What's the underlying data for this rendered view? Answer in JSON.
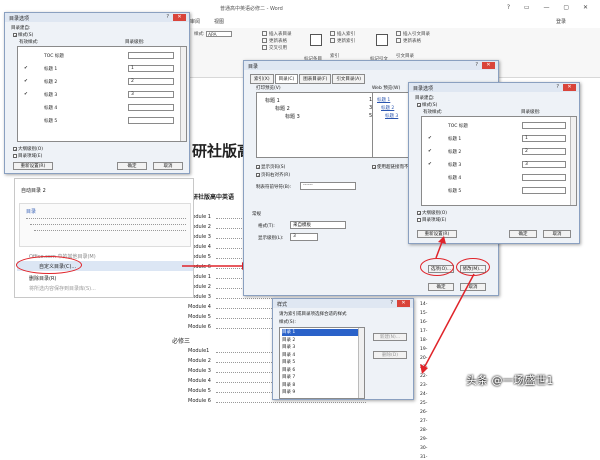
{
  "word": {
    "title": "普通高中英语必修二 - Word",
    "window_controls": "? ▭ — ▢ ✕",
    "signin": "登录",
    "tabs": [
      "审阅",
      "视图"
    ],
    "ribbon": {
      "insert_index": "插入索引",
      "update_index": "更新索引",
      "insert_caption": "插入表目录",
      "update_table": "更新表格",
      "cross_ref": "交叉引用",
      "mark_entry": "标记条目",
      "mark_citation": "标记引文",
      "insert_toa": "插入引文目录",
      "update_toa": "更新表格",
      "style_value": "APA",
      "group_index": "索引",
      "group_toa": "引文目录"
    }
  },
  "document": {
    "heading": "研社版高",
    "subheading": "研社版高中英语",
    "modules": [
      "Module 1",
      "Module 2",
      "Module 3",
      "Module 4",
      "Module 5",
      "Module 6",
      "Module 1",
      "Module 2",
      "Module 3",
      "Module 4",
      "Module 5",
      "Module 6",
      "Module1",
      "Module 2",
      "Module 3",
      "Module 4",
      "Module 5",
      "Module 6"
    ],
    "section_label": "必修三",
    "page_numbers": [
      "10-",
      "11-",
      "12-",
      "13-",
      "14-",
      "15-",
      "16-",
      "17-",
      "18-",
      "19-",
      "20-",
      "21-",
      "22-",
      "23-",
      "24-",
      "25-",
      "26-",
      "27-",
      "28-",
      "29-",
      "30-",
      "31-"
    ]
  },
  "dialog_styles_small": {
    "title": "目录选项",
    "build_from": "目录建自:",
    "styles_check": "样式(S)",
    "available": "有效样式:",
    "toc_level": "目录级别:",
    "rows": [
      {
        "name": "TOC 标题",
        "check": "",
        "level": ""
      },
      {
        "name": "标题 1",
        "check": "✔",
        "level": "1"
      },
      {
        "name": "标题 2",
        "check": "✔",
        "level": "2"
      },
      {
        "name": "标题 3",
        "check": "✔",
        "level": "3"
      },
      {
        "name": "标题 4",
        "check": "",
        "level": ""
      },
      {
        "name": "标题 5",
        "check": "",
        "level": ""
      }
    ],
    "outline": "大纲级别(O)",
    "fields": "目录项域(E)",
    "reset": "重新设置(R)",
    "ok": "确定",
    "cancel": "取消"
  },
  "dropdown": {
    "auto_toc2": "自动目录 2",
    "toc_label": "目录",
    "item_custom": "自定义目录(C)...",
    "item_more": "Office.com 中的其他目录(M)",
    "item_remove": "删除目录(R)",
    "item_save": "将所选内容保存到目录库(S)..."
  },
  "dialog_toc": {
    "title": "目录",
    "tabs": [
      "索引(X)",
      "目录(C)",
      "图表目录(F)",
      "引文目录(A)"
    ],
    "print_preview": "打印预览(V)",
    "web_preview": "Web 预览(W)",
    "preview_items": [
      "标题 1",
      "标题 2",
      "标题 3"
    ],
    "preview_nums": [
      "1",
      "3",
      "5"
    ],
    "web_items": [
      "标题 1",
      "标题 2",
      "标题 3"
    ],
    "show_pages": "显示页码(S)",
    "right_align": "页码右对齐(R)",
    "tab_leader": "制表符前导符(B):",
    "tab_leader_value": "------",
    "use_hyperlinks": "使用超链接而不使用页码(H)",
    "general": "常规",
    "formats": "格式(T):",
    "formats_value": "来自模板",
    "show_levels": "显示级别(L):",
    "show_levels_value": "3",
    "options": "选项(O)...",
    "modify": "修改(M)...",
    "ok": "确定",
    "cancel": "取消"
  },
  "dialog_styles_right": {
    "title": "目录选项",
    "build_from": "目录建自:",
    "styles_check": "样式(S)",
    "available": "有效样式:",
    "toc_level": "目录级别:",
    "rows": [
      {
        "name": "TOC 标题",
        "check": "",
        "level": ""
      },
      {
        "name": "标题 1",
        "check": "✔",
        "level": "1"
      },
      {
        "name": "标题 2",
        "check": "✔",
        "level": "2"
      },
      {
        "name": "标题 3",
        "check": "✔",
        "level": "3"
      },
      {
        "name": "标题 4",
        "check": "",
        "level": ""
      },
      {
        "name": "标题 5",
        "check": "",
        "level": ""
      }
    ],
    "outline": "大纲级别(O)",
    "fields": "目录项域(E)",
    "reset": "重新设置(R)",
    "ok": "确定",
    "cancel": "取消"
  },
  "dialog_style": {
    "title": "样式",
    "prompt": "请为索引或目录项选择合适的样式",
    "styles_label": "样式(S):",
    "list": [
      "目录 1",
      "目录 2",
      "目录 3",
      "目录 4",
      "目录 5",
      "目录 6",
      "目录 7",
      "目录 8",
      "目录 9"
    ],
    "new": "新建(N)...",
    "delete": "删除(D)"
  },
  "watermark": "头条 @一场盛世1"
}
